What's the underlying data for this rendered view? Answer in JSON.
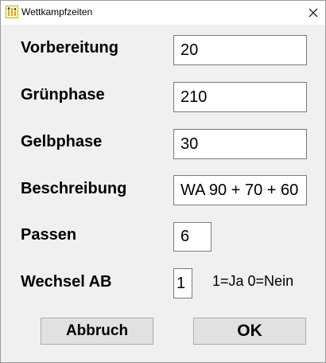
{
  "window": {
    "title": "Wettkampfzeiten",
    "app_icon": "app-icon",
    "close_icon": "close-icon"
  },
  "form": {
    "vorbereitung": {
      "label": "Vorbereitung",
      "value": "20"
    },
    "gruenphase": {
      "label": "Grünphase",
      "value": "210"
    },
    "gelbphase": {
      "label": "Gelbphase",
      "value": "30"
    },
    "beschreibung": {
      "label": "Beschreibung",
      "value": "WA 90 + 70 + 60"
    },
    "passen": {
      "label": "Passen",
      "value": "6"
    },
    "wechsel_ab": {
      "label": "Wechsel AB",
      "value": "1",
      "hint": "1=Ja 0=Nein"
    }
  },
  "buttons": {
    "cancel": "Abbruch",
    "ok": "OK"
  }
}
